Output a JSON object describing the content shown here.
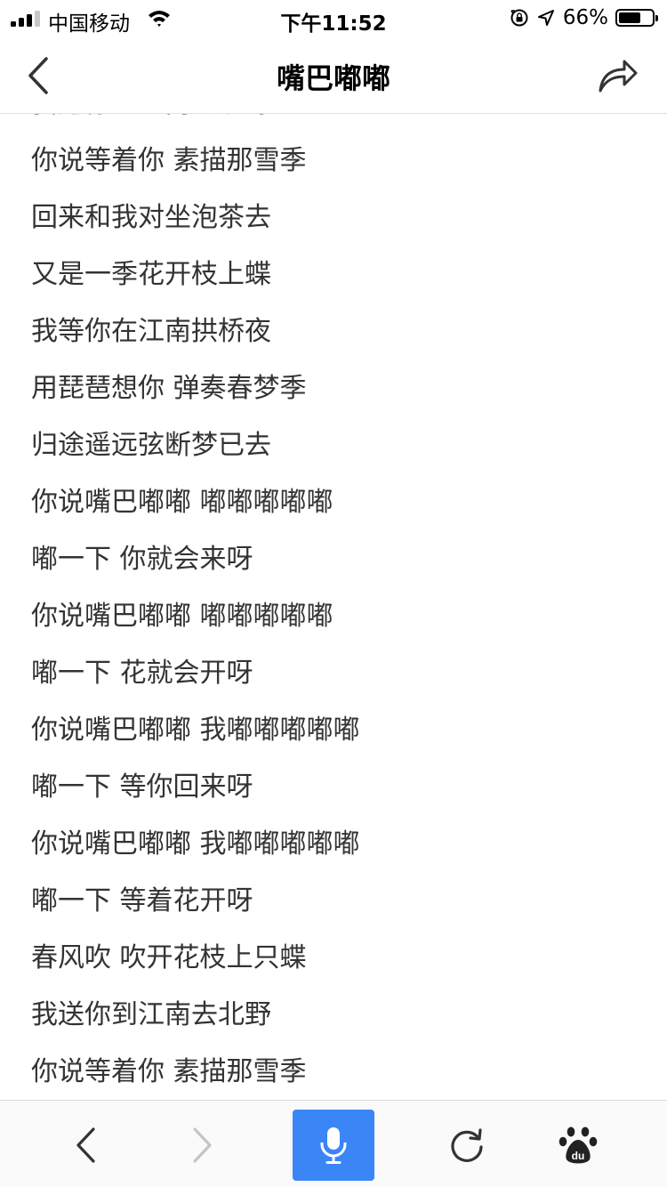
{
  "status_bar": {
    "carrier": "中国移动",
    "time": "下午11:52",
    "battery_text": "66%",
    "battery_level": 0.66,
    "signal_bars_active": 3,
    "signal_bars_total": 4
  },
  "nav": {
    "title": "嘴巴嘟嘟",
    "back_icon": "chevron-left-icon",
    "share_icon": "share-arrow-icon"
  },
  "lyrics": [
    "我送你到江南去北野",
    "你说等着你 素描那雪季",
    "回来和我对坐泡茶去",
    "又是一季花开枝上蝶",
    "我等你在江南拱桥夜",
    "用琵琶想你 弹奏春梦季",
    "归途遥远弦断梦已去",
    "你说嘴巴嘟嘟 嘟嘟嘟嘟嘟",
    "嘟一下 你就会来呀",
    "你说嘴巴嘟嘟 嘟嘟嘟嘟嘟",
    "嘟一下 花就会开呀",
    "你说嘴巴嘟嘟 我嘟嘟嘟嘟嘟",
    "嘟一下 等你回来呀",
    "你说嘴巴嘟嘟 我嘟嘟嘟嘟嘟",
    "嘟一下 等着花开呀",
    "春风吹 吹开花枝上只蝶",
    "我送你到江南去北野",
    "你说等着你 素描那雪季"
  ],
  "toolbar": {
    "icons": [
      "back-icon",
      "forward-icon",
      "microphone-icon",
      "refresh-icon",
      "baidu-paw-icon"
    ],
    "baidu_logo_text": "du",
    "voice_button_color": "#3b86f6",
    "forward_disabled": true
  }
}
